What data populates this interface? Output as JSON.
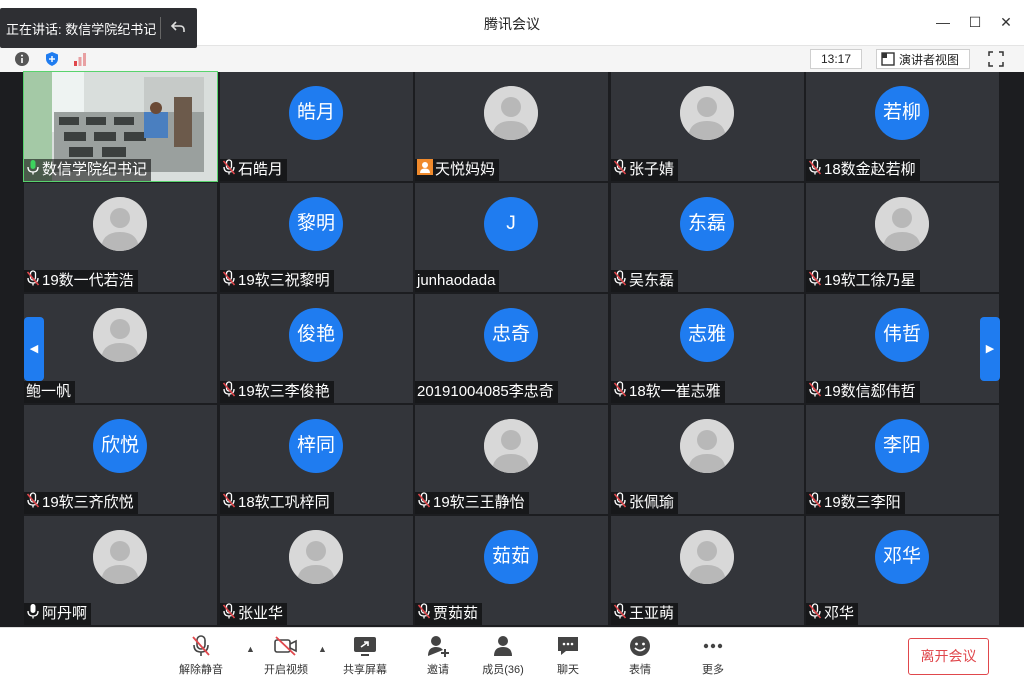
{
  "window": {
    "title": "腾讯会议"
  },
  "speaking": {
    "text": "正在讲话: 数信学院纪书记"
  },
  "infobar": {
    "clock": "13:17",
    "speaker_view": "演讲者视图"
  },
  "participants": [
    {
      "name": "数信学院纪书记",
      "avatar": "",
      "mic": "on",
      "camera": true
    },
    {
      "name": "石皓月",
      "avatar": "皓月",
      "mic": "muted"
    },
    {
      "name": "天悦妈妈",
      "avatar": "",
      "mic": "person",
      "photo": true
    },
    {
      "name": "张子婧",
      "avatar": "",
      "mic": "muted",
      "photo": true
    },
    {
      "name": "18数金赵若柳",
      "avatar": "若柳",
      "mic": "muted"
    },
    {
      "name": "19数一代若浩",
      "avatar": "",
      "mic": "muted",
      "photo": true
    },
    {
      "name": "19软三祝黎明",
      "avatar": "黎明",
      "mic": "muted"
    },
    {
      "name": "junhaodada",
      "avatar": "J",
      "mic": "none"
    },
    {
      "name": "吴东磊",
      "avatar": "东磊",
      "mic": "muted"
    },
    {
      "name": "19软工徐乃星",
      "avatar": "",
      "mic": "muted",
      "photo": true
    },
    {
      "name": "鲍一帆",
      "avatar": "",
      "mic": "none",
      "photo": true
    },
    {
      "name": "19软三李俊艳",
      "avatar": "俊艳",
      "mic": "muted"
    },
    {
      "name": "20191004085李忠奇",
      "avatar": "忠奇",
      "mic": "none"
    },
    {
      "name": "18软一崔志雅",
      "avatar": "志雅",
      "mic": "muted"
    },
    {
      "name": "19数信郄伟哲",
      "avatar": "伟哲",
      "mic": "muted"
    },
    {
      "name": "19软三齐欣悦",
      "avatar": "欣悦",
      "mic": "muted"
    },
    {
      "name": "18软工巩梓同",
      "avatar": "梓同",
      "mic": "muted"
    },
    {
      "name": "19软三王静怡",
      "avatar": "",
      "mic": "muted",
      "photo": true
    },
    {
      "name": "张佩瑜",
      "avatar": "",
      "mic": "muted",
      "photo": true
    },
    {
      "name": "19数三李阳",
      "avatar": "李阳",
      "mic": "muted"
    },
    {
      "name": "阿丹啊",
      "avatar": "",
      "mic": "on",
      "photo": true
    },
    {
      "name": "张业华",
      "avatar": "",
      "mic": "muted",
      "photo": true
    },
    {
      "name": "贾茹茹",
      "avatar": "茹茹",
      "mic": "muted"
    },
    {
      "name": "王亚萌",
      "avatar": "",
      "mic": "muted",
      "photo": true
    },
    {
      "name": "邓华",
      "avatar": "邓华",
      "mic": "muted"
    }
  ],
  "toolbar": {
    "unmute": "解除静音",
    "start_video": "开启视频",
    "share_screen": "共享屏幕",
    "invite": "邀请",
    "members": "成员(36)",
    "chat": "聊天",
    "reactions": "表情",
    "more": "更多",
    "leave": "离开会议"
  },
  "colors": {
    "accent": "#1f7cf0",
    "danger": "#e0474c",
    "tile_bg": "#33353a",
    "grid_bg": "#1c1d20"
  }
}
